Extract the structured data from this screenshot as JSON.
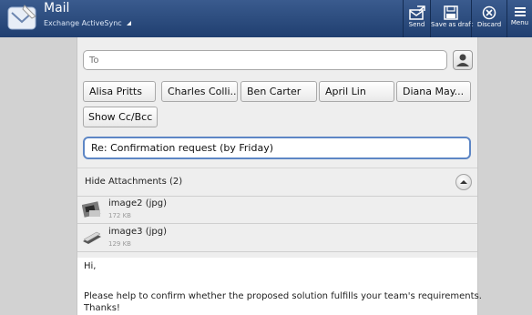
{
  "header": {
    "title": "Mail",
    "account": "Exchange ActiveSync",
    "actions": {
      "send": "Send",
      "save_draft": "Save as draft",
      "discard": "Discard",
      "menu": "Menu"
    }
  },
  "compose": {
    "to_placeholder": "To",
    "recipients": [
      "Alisa Pritts",
      "Charles Colli...",
      "Ben Carter",
      "April Lin",
      "Diana May..."
    ],
    "cc_bcc_label": "Show Cc/Bcc",
    "subject": "Re: Confirmation request (by Friday)"
  },
  "attachments": {
    "header": "Hide Attachments (2)",
    "items": [
      {
        "name": "image2 (jpg)",
        "size": "172 KB"
      },
      {
        "name": "image3 (jpg)",
        "size": "129 KB"
      }
    ]
  },
  "body": {
    "greeting": "Hi,",
    "line1": "Please help to confirm whether the proposed solution fulfills your team's requirements.",
    "line2": "Thanks!"
  }
}
